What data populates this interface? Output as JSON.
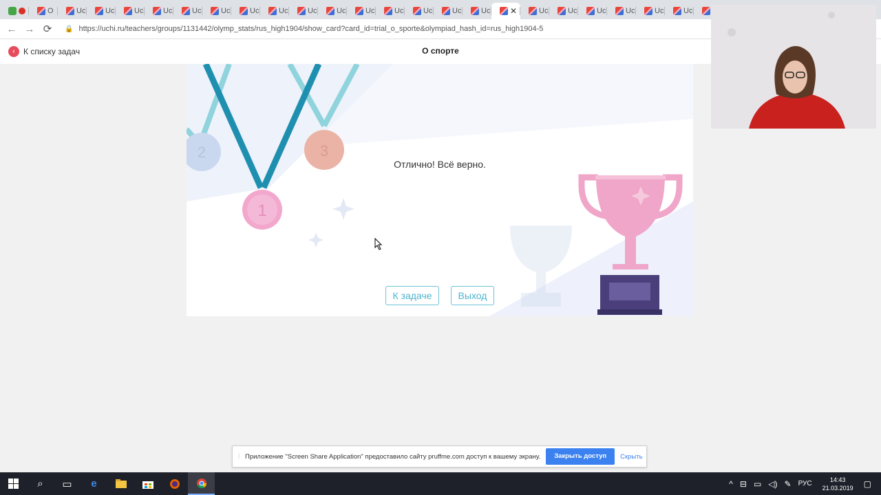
{
  "browser": {
    "tabs": [
      {
        "label": "",
        "kind": "first"
      },
      {
        "label": "О",
        "kind": "page"
      },
      {
        "label": "Uc",
        "kind": "page"
      },
      {
        "label": "Uc",
        "kind": "page"
      },
      {
        "label": "Uc",
        "kind": "page"
      },
      {
        "label": "Uc",
        "kind": "page"
      },
      {
        "label": "Uc",
        "kind": "page"
      },
      {
        "label": "Uc",
        "kind": "page"
      },
      {
        "label": "Uc",
        "kind": "page"
      },
      {
        "label": "Uc",
        "kind": "page"
      },
      {
        "label": "Uc",
        "kind": "page"
      },
      {
        "label": "Uc",
        "kind": "page"
      },
      {
        "label": "Uc",
        "kind": "page"
      },
      {
        "label": "Uc",
        "kind": "page"
      },
      {
        "label": "Uc",
        "kind": "page"
      },
      {
        "label": "Uc",
        "kind": "page"
      },
      {
        "label": "Uc",
        "kind": "page"
      },
      {
        "label": "",
        "kind": "active"
      },
      {
        "label": "Uc",
        "kind": "page"
      },
      {
        "label": "Uc",
        "kind": "page"
      },
      {
        "label": "Uc",
        "kind": "page"
      },
      {
        "label": "Uc",
        "kind": "page"
      },
      {
        "label": "Uc",
        "kind": "page"
      },
      {
        "label": "Uc",
        "kind": "page"
      },
      {
        "label": "Uc",
        "kind": "page"
      }
    ],
    "url": "https://uchi.ru/teachers/groups/1131442/olymp_stats/rus_high1904/show_card?card_id=trial_o_sporte&olympiad_hash_id=rus_high1904-5"
  },
  "page": {
    "back_label": "К списку задач",
    "title": "О спорте"
  },
  "card": {
    "message": "Отлично! Всё верно.",
    "task_button": "К задаче",
    "exit_button": "Выход",
    "medal_labels": [
      "1",
      "2",
      "3"
    ]
  },
  "share_bar": {
    "text": "Приложение \"Screen Share Application\" предоставило сайту pruffme.com доступ к вашему экрану.",
    "stop_label": "Закрыть доступ",
    "hide_label": "Скрыть"
  },
  "taskbar": {
    "language": "РУС",
    "time": "14:43",
    "date": "21.03.2019"
  },
  "colors": {
    "accent_red": "#e74c5c",
    "button_teal": "#4cb4cf",
    "share_blue": "#3b82f0",
    "trophy_pink": "#f0a6c8",
    "trophy_base": "#4a3f7a"
  }
}
